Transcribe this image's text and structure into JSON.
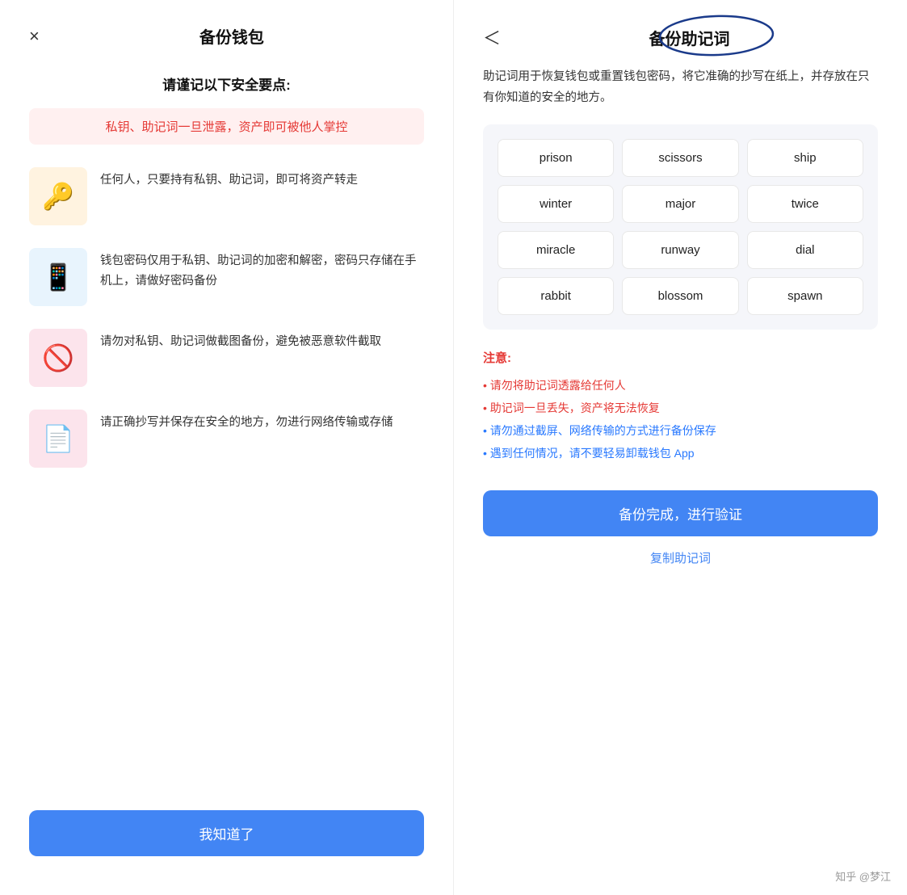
{
  "left": {
    "close_label": "×",
    "title": "备份钱包",
    "subtitle": "请谨记以下安全要点:",
    "warning": "私钥、助记词一旦泄露，资产即可被他人掌控",
    "items": [
      {
        "icon": "🔑",
        "icon_class": "icon-key",
        "desc": "任何人，只要持有私钥、助记词，即可将资产转走"
      },
      {
        "icon": "📱",
        "icon_class": "icon-phone",
        "desc": "钱包密码仅用于私钥、助记词的加密和解密，密码只存储在手机上，请做好密码备份"
      },
      {
        "icon": "🚫",
        "icon_class": "icon-screenshot",
        "desc": "请勿对私钥、助记词做截图备份，避免被恶意软件截取"
      },
      {
        "icon": "📄",
        "icon_class": "icon-note",
        "desc": "请正确抄写并保存在安全的地方，勿进行网络传输或存储"
      }
    ],
    "confirm_btn": "我知道了"
  },
  "right": {
    "back_label": "＜",
    "title": "备份助记词",
    "desc": "助记词用于恢复钱包或重置钱包密码，将它准确的抄写在纸上，并存放在只有你知道的安全的地方。",
    "mnemonic_words": [
      "prison",
      "scissors",
      "ship",
      "winter",
      "major",
      "twice",
      "miracle",
      "runway",
      "dial",
      "rabbit",
      "blossom",
      "spawn"
    ],
    "notice_title": "注意:",
    "notice_items": [
      {
        "text": "• 请勿将助记词透露给任何人",
        "color": "red"
      },
      {
        "text": "• 助记词一旦丢失，资产将无法恢复",
        "color": "red"
      },
      {
        "text": "• 请勿通过截屏、网络传输的方式进行备份保存",
        "color": "blue"
      },
      {
        "text": "• 遇到任何情况，请不要轻易卸载钱包 App",
        "color": "blue"
      }
    ],
    "confirm_btn": "备份完成，进行验证",
    "copy_link": "复制助记词"
  },
  "watermark": "知乎 @梦江"
}
